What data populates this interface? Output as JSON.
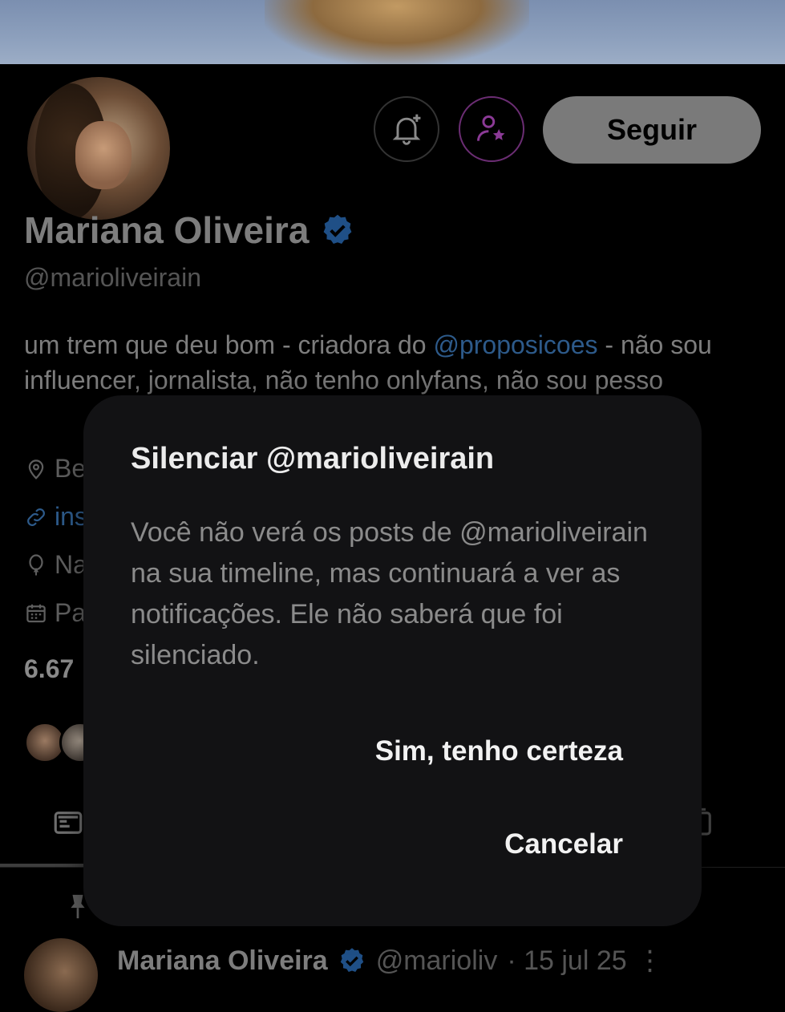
{
  "profile": {
    "name": "Mariana Oliveira",
    "handle": "@marioliveirain",
    "bio_before": "um trem que deu bom - criadora do ",
    "bio_mention": "@proposicoes",
    "bio_after": " - não sou influencer, jornalista, não tenho onlyfans, não sou pesso",
    "location_partial": "Be",
    "link_partial": "ins",
    "birthday_partial": "Na",
    "joined_partial": "Pa",
    "following_partial": "6.67",
    "follow_label": "Seguir",
    "verified_color": "#1d9bf0"
  },
  "post": {
    "name": "Mariana Oliveira",
    "handle": "@marioliv",
    "date": "· 15 jul 25"
  },
  "dialog": {
    "title": "Silenciar @marioliveirain",
    "body": "Você não verá os posts de @marioliveirain na sua timeline, mas continuará a ver as notificações. Ele não saberá que foi silenciado.",
    "confirm_label": "Sim, tenho certeza",
    "cancel_label": "Cancelar"
  },
  "icons": {
    "bell": "bell-plus-icon",
    "subscribe": "person-star-icon",
    "verified": "verified-badge-icon",
    "location": "location-pin-icon",
    "link": "link-icon",
    "birthday": "balloon-icon",
    "calendar": "calendar-icon",
    "pinned": "pin-icon"
  }
}
